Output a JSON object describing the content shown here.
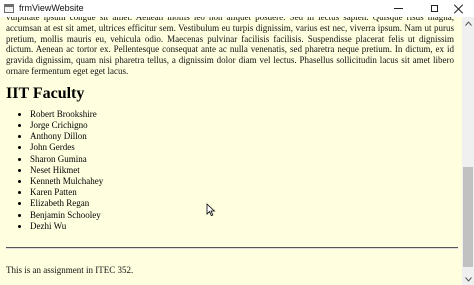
{
  "window": {
    "title": "frmViewWebsite",
    "icon": "form-window-icon"
  },
  "page": {
    "background": "#ffffe0",
    "lorem": "vulputate ipsum congue sit amet. Aenean mollis leo non aliquet posuere. Sed in lectus sapien. Quisque risus magna, accumsan at est sit amet, ultrices efficitur sem. Vestibulum eu turpis dignissim, varius est nec, viverra ipsum. Nam ut purus pretium, mollis mauris eu, vehicula odio. Maecenas pulvinar facilisis facilisis. Suspendisse placerat felis ut dignissim dictum. Aenean ac tortor ex. Pellentesque consequat ante ac nulla venenatis, sed pharetra neque pretium. In dictum, ex id gravida dignissim, quam nisi pharetra tellus, a dignissim dolor diam vel lectus. Phasellus sollicitudin lacus sit amet libero ornare fermentum eget eget lacus.",
    "faculty_heading": "IIT Faculty",
    "faculty": [
      "Robert Brookshire",
      "Jorge Crichigno",
      "Anthony Dillon",
      "John Gerdes",
      "Sharon Gumina",
      "Neset Hikmet",
      "Kenneth Mulchahey",
      "Karen Patten",
      "Elizabeth Regan",
      "Benjamin Schooley",
      "Dezhi Wu"
    ],
    "footer": "This is an assignment in ITEC 352."
  }
}
